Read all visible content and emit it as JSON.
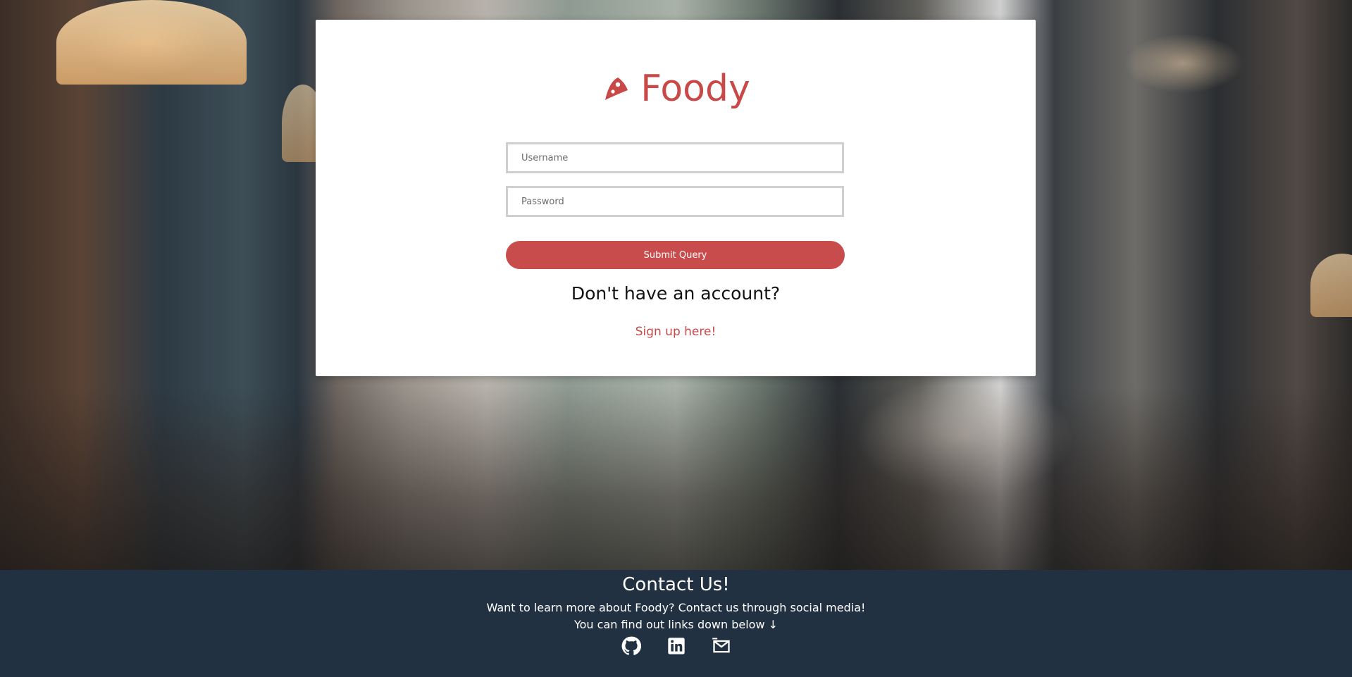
{
  "brand": {
    "name": "Foody",
    "accent_color": "#c94848",
    "icon": "pizza-slice-icon"
  },
  "login_form": {
    "username_placeholder": "Username",
    "password_placeholder": "Password",
    "submit_label": "Submit Query",
    "no_account_text": "Don't have an account?",
    "signup_link": "Sign up here!"
  },
  "footer": {
    "background_color": "#223142",
    "title": "Contact Us!",
    "line1": "Want to learn more about Foody? Contact us through social media!",
    "line2": "You can find out links down below ↓",
    "social_icons": [
      "github-icon",
      "linkedin-icon",
      "mail-icon"
    ]
  }
}
